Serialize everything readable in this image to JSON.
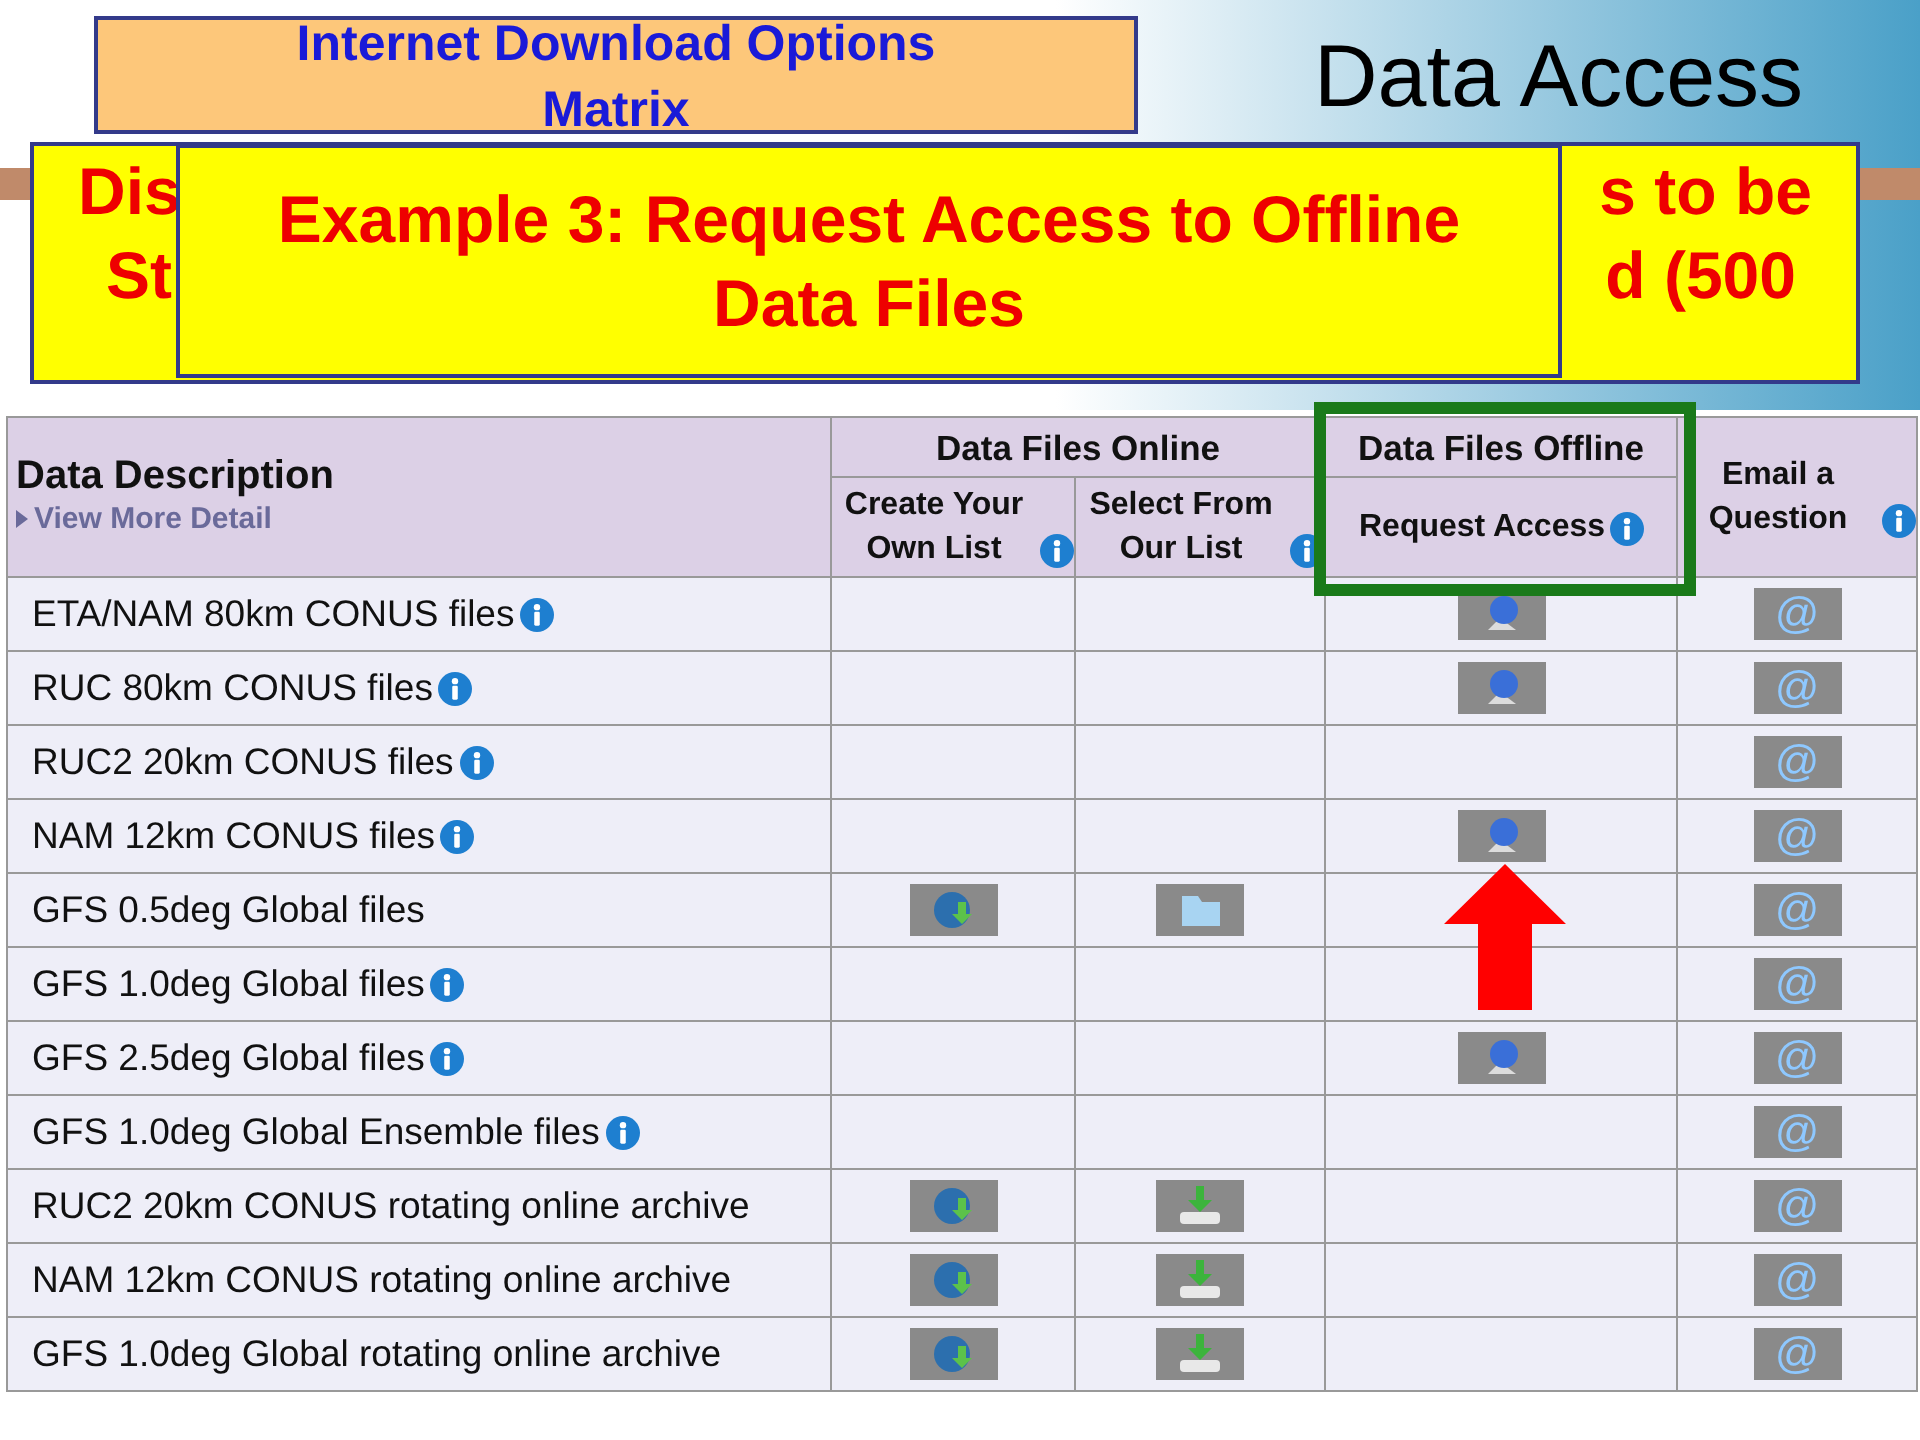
{
  "slide": {
    "title": "Data Access"
  },
  "callout_back": {
    "title_lines": [
      "Internet Download Options",
      "Matrix"
    ]
  },
  "callout_middle": {
    "left_lines": [
      "Dis",
      "St"
    ],
    "right_lines": [
      "s to be",
      "d (500"
    ]
  },
  "callout_front": {
    "text": "Example 3: Request Access to Offline Data Files"
  },
  "table": {
    "description_header": "Data Description",
    "detail_link": "View More Detail",
    "online_group": "Data Files Online",
    "offline_group": "Data Files Offline",
    "columns": [
      {
        "label": "Create Your Own List",
        "info": true
      },
      {
        "label": "Select From Our List",
        "info": true
      },
      {
        "label": "Request Access",
        "info": true
      },
      {
        "label": "Email a Question",
        "info": true
      }
    ],
    "rows": [
      {
        "name": "ETA/NAM 80km CONUS files",
        "info": true,
        "create": null,
        "select": null,
        "request": true,
        "email": "@"
      },
      {
        "name": "RUC 80km CONUS files",
        "info": true,
        "create": null,
        "select": null,
        "request": true,
        "email": "@"
      },
      {
        "name": "RUC2 20km CONUS files",
        "info": true,
        "create": null,
        "select": null,
        "request": false,
        "email": "@"
      },
      {
        "name": "NAM 12km CONUS files",
        "info": true,
        "create": null,
        "select": null,
        "request": true,
        "email": "@"
      },
      {
        "name": "GFS 0.5deg Global files",
        "info": false,
        "create": {
          "kind": "globe"
        },
        "select": {
          "kind": "folder"
        },
        "request": false,
        "email": "@"
      },
      {
        "name": "GFS 1.0deg Global files",
        "info": true,
        "create": null,
        "select": null,
        "request": false,
        "email": "@"
      },
      {
        "name": "GFS 2.5deg Global files",
        "info": true,
        "create": null,
        "select": null,
        "request": true,
        "email": "@"
      },
      {
        "name": "GFS 1.0deg Global Ensemble files",
        "info": true,
        "create": null,
        "select": null,
        "request": false,
        "email": "@"
      },
      {
        "name": "RUC2 20km CONUS rotating online archive",
        "info": false,
        "create": {
          "kind": "globe"
        },
        "select": {
          "kind": "drive"
        },
        "request": false,
        "email": "@"
      },
      {
        "name": "NAM 12km CONUS rotating online archive",
        "info": false,
        "create": {
          "kind": "globe"
        },
        "select": {
          "kind": "drive"
        },
        "request": false,
        "email": "@"
      },
      {
        "name": "GFS 1.0deg Global rotating online archive",
        "info": false,
        "create": {
          "kind": "globe"
        },
        "select": {
          "kind": "drive"
        },
        "request": false,
        "email": "@"
      }
    ]
  }
}
